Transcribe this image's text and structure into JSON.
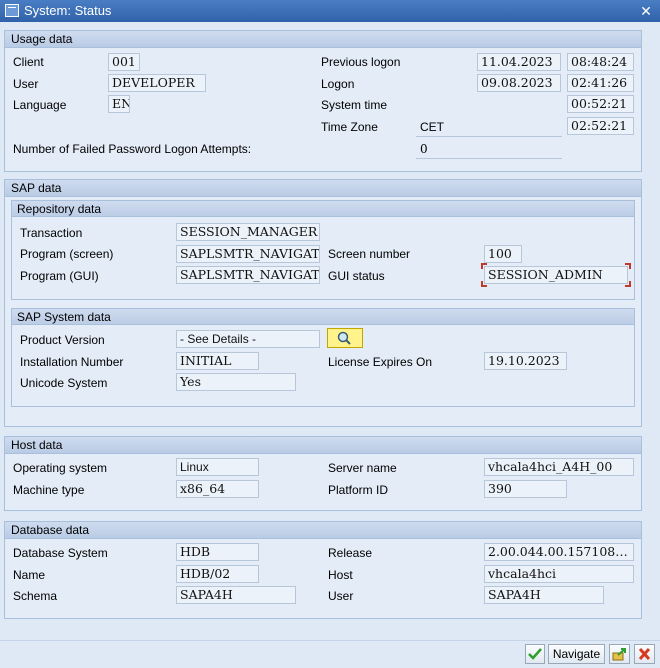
{
  "window": {
    "title": "System: Status"
  },
  "usage": {
    "header": "Usage data",
    "client_label": "Client",
    "client": "001",
    "user_label": "User",
    "user": "DEVELOPER",
    "language_label": "Language",
    "language": "EN",
    "prev_logon_label": "Previous logon",
    "prev_logon_date": "11.04.2023",
    "prev_logon_time": "08:48:24",
    "logon_label": "Logon",
    "logon_date": "09.08.2023",
    "logon_time": "02:41:26",
    "system_time_label": "System time",
    "system_time": "00:52:21",
    "timezone_label": "Time Zone",
    "timezone": "CET",
    "timezone_time": "02:52:21",
    "failed_label": "Number of Failed Password Logon Attempts:",
    "failed": "0"
  },
  "sap": {
    "header": "SAP data",
    "repo": {
      "header": "Repository data",
      "transaction_label": "Transaction",
      "transaction": "SESSION_MANAGER",
      "program_screen_label": "Program (screen)",
      "program_screen": "SAPLSMTR_NAVIGATI…",
      "screen_number_label": "Screen number",
      "screen_number": "100",
      "program_gui_label": "Program (GUI)",
      "program_gui": "SAPLSMTR_NAVIGATI…",
      "gui_status_label": "GUI status",
      "gui_status": "SESSION_ADMIN"
    },
    "system": {
      "header": "SAP System data",
      "product_label": "Product Version",
      "product": "- See Details -",
      "install_label": "Installation Number",
      "install": "INITIAL",
      "license_label": "License Expires On",
      "license": "19.10.2023",
      "unicode_label": "Unicode System",
      "unicode": "Yes"
    }
  },
  "host": {
    "header": "Host data",
    "os_label": "Operating system",
    "os": "Linux",
    "server_label": "Server name",
    "server": "vhcala4hci_A4H_00",
    "machine_label": "Machine type",
    "machine": "x86_64",
    "platform_label": "Platform ID",
    "platform": "390"
  },
  "db": {
    "header": "Database data",
    "system_label": "Database System",
    "system": "HDB",
    "release_label": "Release",
    "release": "2.00.044.00.157108…",
    "name_label": "Name",
    "name": "HDB/02",
    "host_label": "Host",
    "host": "vhcala4hci",
    "schema_label": "Schema",
    "schema": "SAPA4H",
    "user_label": "User",
    "user": "SAPA4H"
  },
  "buttons": {
    "navigate": "Navigate"
  },
  "colors": {
    "title_bar": "#2f62a8",
    "confirm": "#2e9e2e",
    "cancel": "#d83a1e",
    "details_button": "#fff38a"
  }
}
